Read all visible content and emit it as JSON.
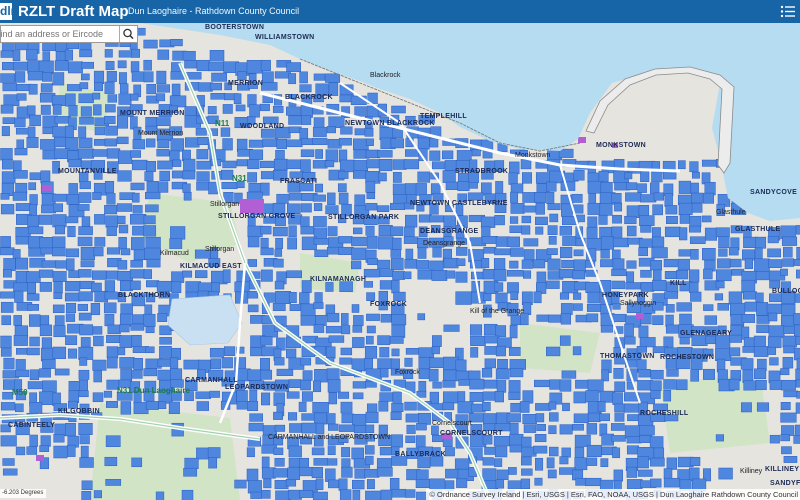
{
  "header": {
    "logo_text": "dlr",
    "app_title": "RZLT Draft Map",
    "subtitle": "Dun Laoghaire - Rathdown County Council"
  },
  "search": {
    "placeholder": "Find an address or Eircode",
    "button_icon": "search-icon"
  },
  "menu": {
    "icon": "menu-list-icon"
  },
  "map": {
    "colors": {
      "header": "#1765a6",
      "sea": "#b5dcf0",
      "land": "#e6e4de",
      "zoned": "#4f86de",
      "zoned_outline": "#2a5fc2",
      "purple": "#b25fd6",
      "green": "#d2e4c6",
      "road": "#ffffff"
    },
    "place_labels": [
      "BOOTERSTOWN",
      "WILLIAMSTOWN",
      "MERRION",
      "BLACKROCK",
      "Blackrock",
      "NEWTOWN BLACKROCK",
      "TEMPLEHILL",
      "MOUNT MERRION",
      "Mount Merrion",
      "WOODLAND",
      "FRASCATI",
      "STRADBROOK",
      "Monkstown",
      "MONKSTOWN",
      "BULLOCK",
      "Glasthule",
      "GLASTHULE",
      "SANDYCOVE",
      "MOUNTANVILLE",
      "Stillorgan",
      "STILLORGAN GROVE",
      "STILLORGAN PARK",
      "NEWTOWN CASTLEBYRNE",
      "DEANSGRANGE",
      "Deansgrange",
      "KILLINEY",
      "KILMACUD EAST",
      "Kilmacud",
      "Stillorgan",
      "KILNAMANAGH",
      "Kill of the Grange",
      "HONEYPARK",
      "Sallynoggin",
      "KILL",
      "GLENAGEARY",
      "BLACKTHORN",
      "CARMANHALL",
      "LEOPARDSTOWN",
      "CARMANHALL and LEOPARDSTOWN",
      "FOXROCK",
      "Foxrock",
      "Cornelscourt",
      "CORNELSCOURT",
      "BALLYBRACK",
      "THOMASTOWN",
      "ROCHESTOWN",
      "ROCHESHILL",
      "Killiney",
      "SANDYFORD",
      "KILGOBBIN",
      "CABINTEELY"
    ],
    "road_labels": [
      "N11",
      "N31",
      "M50",
      "N31 Dun Laoghaire"
    ],
    "scale_text": "-6.203 Degrees",
    "attribution": "© Ordnance Survey Ireland | Esri, USGS | Esri, FAO, NOAA, USGS | Dun Laoghaire Rathdown County Council"
  }
}
